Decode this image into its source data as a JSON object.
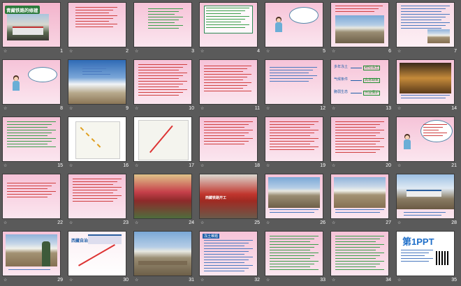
{
  "slides": [
    {
      "num": "1",
      "title": "青藏铁路的修建"
    },
    {
      "num": "2"
    },
    {
      "num": "3"
    },
    {
      "num": "4"
    },
    {
      "num": "5"
    },
    {
      "num": "6"
    },
    {
      "num": "7"
    },
    {
      "num": "8"
    },
    {
      "num": "9"
    },
    {
      "num": "10"
    },
    {
      "num": "11"
    },
    {
      "num": "12"
    },
    {
      "num": "13"
    },
    {
      "num": "14"
    },
    {
      "num": "15"
    },
    {
      "num": "16"
    },
    {
      "num": "17"
    },
    {
      "num": "18"
    },
    {
      "num": "19"
    },
    {
      "num": "20"
    },
    {
      "num": "21"
    },
    {
      "num": "22"
    },
    {
      "num": "23"
    },
    {
      "num": "24"
    },
    {
      "num": "25"
    },
    {
      "num": "26"
    },
    {
      "num": "27"
    },
    {
      "num": "28"
    },
    {
      "num": "29"
    },
    {
      "num": "30"
    },
    {
      "num": "31"
    },
    {
      "num": "32"
    },
    {
      "num": "33"
    },
    {
      "num": "34"
    },
    {
      "num": "35"
    }
  ],
  "slide1_title": "青藏铁路的修建",
  "slide13_labels": [
    "多年冻土",
    "对付冻土",
    "气候条件",
    "高寒缺氧",
    "脆弱生态",
    "环境保护"
  ],
  "slide25_label": "西藏铁路开工",
  "slide30_label": "西藏自治区",
  "slide32_title": "冻土难题",
  "slide35_logo": "第1PPT",
  "colors": {
    "pink": "#f6c3d8",
    "green": "#1f8f2f",
    "red": "#c01b1b",
    "blue": "#1f5fa8",
    "bg": "#5a5a5a"
  }
}
